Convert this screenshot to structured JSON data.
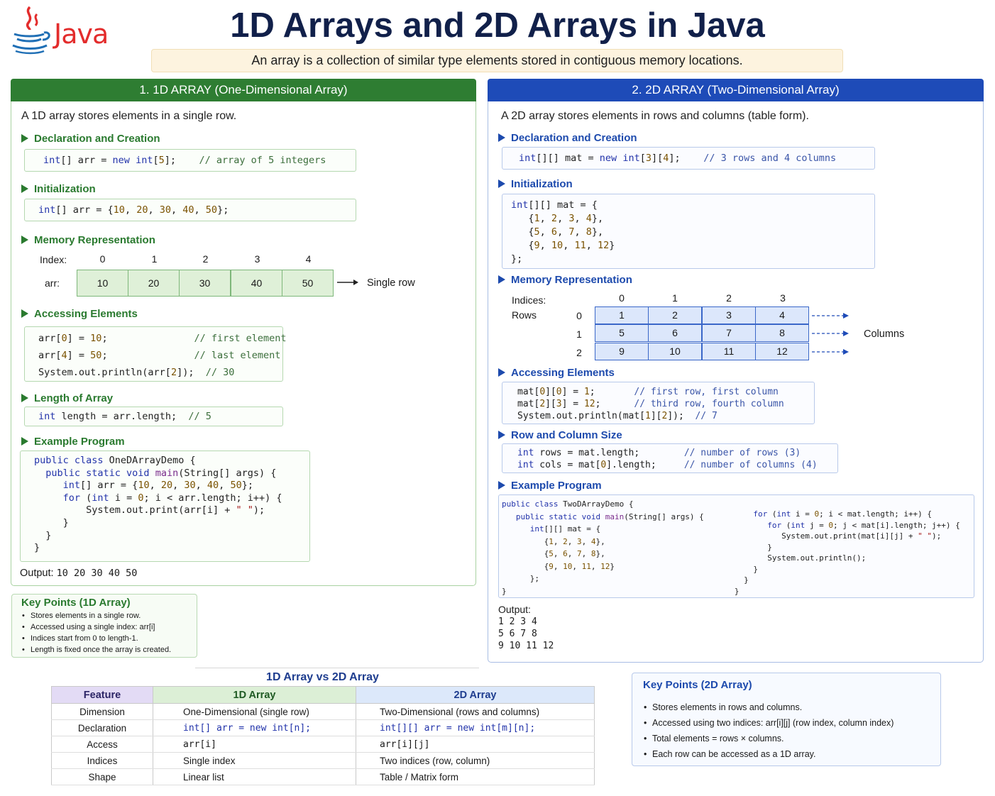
{
  "header": {
    "logo_text": "Java",
    "title": "1D Arrays and 2D Arrays in Java",
    "subtitle": "An array is a collection of similar type elements stored in contiguous memory locations."
  },
  "panel_1d": {
    "heading": "1. 1D ARRAY (One-Dimensional Array)",
    "intro": "A 1D array stores elements in a single row.",
    "sections": {
      "declaration": "Declaration and Creation",
      "initialization": "Initialization",
      "memory": "Memory Representation",
      "accessing": "Accessing Elements",
      "length": "Length of Array",
      "example": "Example Program"
    },
    "memory": {
      "index_label": "Index:",
      "arr_label": "arr:",
      "indices": [
        "0",
        "1",
        "2",
        "3",
        "4"
      ],
      "values": [
        "10",
        "20",
        "30",
        "40",
        "50"
      ],
      "note": "Single row"
    },
    "output_label": "Output:",
    "output_value": "10 20 30 40 50"
  },
  "panel_2d": {
    "heading": "2. 2D ARRAY (Two-Dimensional Array)",
    "intro": "A 2D array stores elements in rows and columns (table form).",
    "sections": {
      "declaration": "Declaration and Creation",
      "initialization": "Initialization",
      "memory": "Memory Representation",
      "accessing": "Accessing Elements",
      "size": "Row and Column Size",
      "example": "Example Program"
    },
    "memory": {
      "indices_label": "Indices:",
      "rows_label": "Rows",
      "col_indices": [
        "0",
        "1",
        "2",
        "3"
      ],
      "row_indices": [
        "0",
        "1",
        "2"
      ],
      "grid": [
        [
          "1",
          "2",
          "3",
          "4"
        ],
        [
          "5",
          "6",
          "7",
          "8"
        ],
        [
          "9",
          "10",
          "11",
          "12"
        ]
      ],
      "columns_label": "Columns"
    },
    "output_label": "Output:",
    "output_lines": [
      "1 2 3 4",
      "5 6 7 8",
      "9 10 11 12"
    ]
  },
  "key_points_1d": {
    "title": "Key Points (1D Array)",
    "items": [
      "Stores elements in a single row.",
      "Accessed using a single index: arr[i]",
      "Indices start from 0 to length-1.",
      "Length is fixed once the array is created."
    ]
  },
  "key_points_2d": {
    "title": "Key Points (2D Array)",
    "items": [
      "Stores elements in rows and columns.",
      "Accessed using two indices: arr[i][j] (row index, column index)",
      "Total elements = rows × columns.",
      "Each row can be accessed as a 1D array."
    ]
  },
  "comparison": {
    "title": "1D Array vs 2D Array",
    "headers": [
      "Feature",
      "1D Array",
      "2D Array"
    ],
    "rows": [
      [
        "Dimension",
        "One-Dimensional (single row)",
        "Two-Dimensional (rows and columns)"
      ],
      [
        "Declaration",
        "int[] arr = new int[n];",
        "int[][] arr = new int[m][n];"
      ],
      [
        "Access",
        "arr[i]",
        "arr[i][j]"
      ],
      [
        "Indices",
        "Single index",
        "Two indices (row, column)"
      ],
      [
        "Shape",
        "Linear list",
        "Table / Matrix form"
      ]
    ]
  },
  "colors": {
    "green_header": "#2e7d32",
    "blue_header": "#1e4bb8",
    "title": "#11204a",
    "cell_1d": "#dff0d8",
    "cell_2d": "#dce7fb"
  },
  "icons": {
    "logo": "java-coffee-cup-icon",
    "section_marker": "triangle-right-icon",
    "arrow": "arrow-right-icon"
  }
}
